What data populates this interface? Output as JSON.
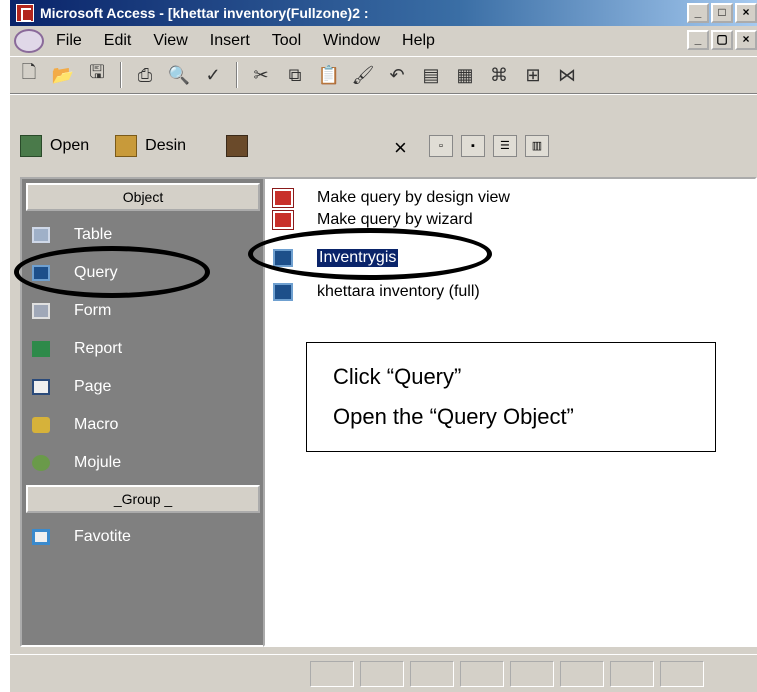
{
  "window": {
    "title": "Microsoft Access - [khettar inventory(Fullzone)2 :",
    "buttons": [
      "_",
      "□",
      "×"
    ]
  },
  "menubar": {
    "items": [
      "File",
      "Edit",
      "View",
      "Insert",
      "Tool",
      "Window",
      "Help"
    ],
    "doc_buttons": [
      "_",
      "▢",
      "×"
    ]
  },
  "db_toolbar": {
    "open_label": "Open",
    "design_label": "Desin",
    "delete_symbol": "×"
  },
  "sidebar": {
    "objects_header": "Object",
    "items": [
      {
        "label": "Table",
        "icon": "table-icon"
      },
      {
        "label": "Query",
        "icon": "query-icon"
      },
      {
        "label": "Form",
        "icon": "form-icon"
      },
      {
        "label": "Report",
        "icon": "report-icon"
      },
      {
        "label": "Page",
        "icon": "page-icon"
      },
      {
        "label": "Macro",
        "icon": "macro-icon"
      },
      {
        "label": "Mojule",
        "icon": "module-icon"
      }
    ],
    "groups_header": "_Group _",
    "group_items": [
      {
        "label": "Favotite",
        "icon": "favorites-icon"
      }
    ]
  },
  "list": {
    "items": [
      {
        "label": "Make query by design view",
        "icon": "make-query-icon"
      },
      {
        "label": "Make query by wizard",
        "icon": "make-query-icon"
      },
      {
        "label": "Inventrygis",
        "icon": "query-icon",
        "selected": true
      },
      {
        "label": "khettara inventory (full)",
        "icon": "query-icon"
      }
    ]
  },
  "callout": {
    "line1": "Click “Query”",
    "line2": "Open the “Query Object”"
  },
  "colors": {
    "title_bar": "#0a246a",
    "chrome": "#d4d0c8",
    "sidebar_bg": "#808080",
    "selection": "#0a246a"
  }
}
